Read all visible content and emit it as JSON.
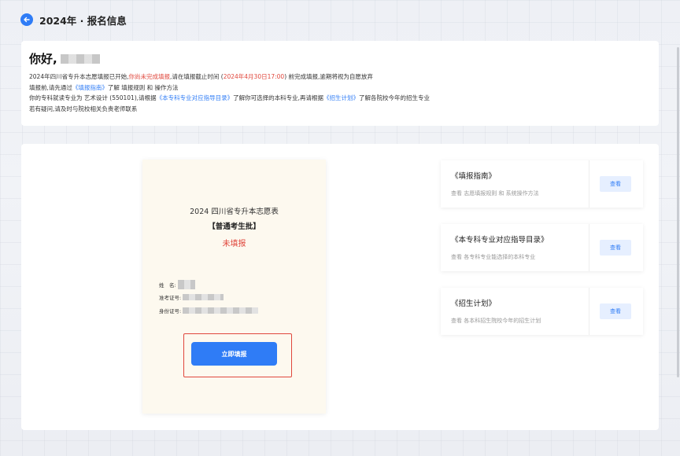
{
  "header": {
    "title": "2024年 · 报名信息"
  },
  "info": {
    "greeting": "你好,",
    "line1": {
      "a": "2024年四川省专升本志愿填报已开始,",
      "b": "你尚未完成填报",
      "c": ",请在填报截止时间 (",
      "d": "2024年4月30日17:00",
      "e": ") 前完成填报,逾期将视为自愿放弃"
    },
    "line2": {
      "a": "填报前,请先通过",
      "b": "《填报指南》",
      "c": "了解 填报规则 和 操作方法"
    },
    "line3": {
      "a": "你的专科就读专业为 艺术设计 (550101),请根据",
      "b": "《本专科专业对应指导目录》",
      "c": "了解你可选择的本科专业,再请根据",
      "d": "《招生计划》",
      "e": "了解各院校今年的招生专业"
    },
    "line4": "若有疑问,请及时与院校相关负责老师联系"
  },
  "form": {
    "title": "2024 四川省专升本志愿表",
    "batch": "【普通考生批】",
    "status": "未填报",
    "name_label": "姓　名:",
    "exam_label": "准考证号:",
    "id_label": "身份证号:",
    "submit_label": "立即填报"
  },
  "guides": [
    {
      "title": "《填报指南》",
      "desc": "查看 志愿填报规则 和 系统操作方法",
      "button": "查看"
    },
    {
      "title": "《本专科专业对应指导目录》",
      "desc": "查看 各专科专业能选择的本科专业",
      "button": "查看"
    },
    {
      "title": "《招生计划》",
      "desc": "查看 各本科招生院校今年的招生计划",
      "button": "查看"
    }
  ],
  "colors": {
    "accent": "#2f7cf6",
    "alert": "#e0473c"
  }
}
